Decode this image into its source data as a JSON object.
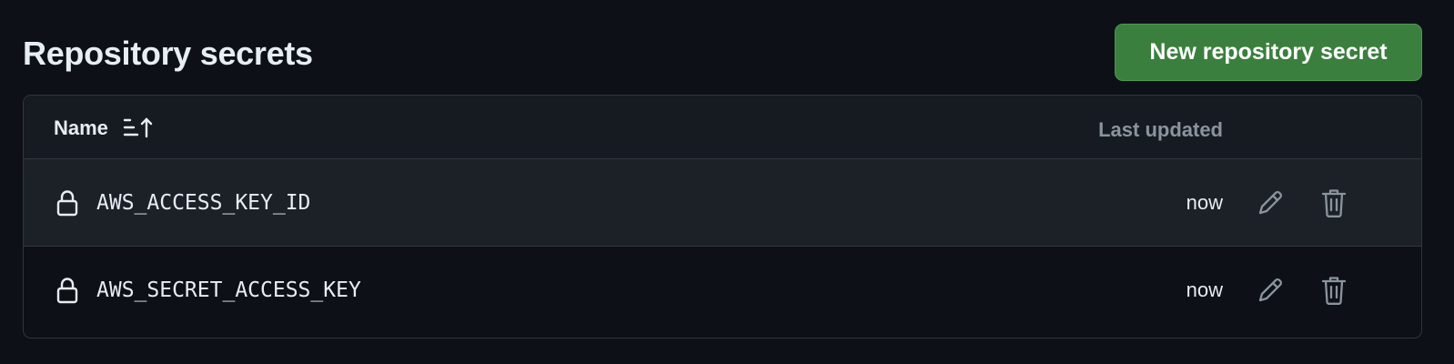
{
  "header": {
    "title": "Repository secrets",
    "new_button_label": "New repository secret"
  },
  "table": {
    "columns": {
      "name": "Name",
      "last_updated": "Last updated"
    },
    "sort_icon": "sort-ascending-icon",
    "rows": [
      {
        "name": "AWS_ACCESS_KEY_ID",
        "updated": "now"
      },
      {
        "name": "AWS_SECRET_ACCESS_KEY",
        "updated": "now"
      }
    ],
    "row_icons": [
      "lock-icon",
      "pencil-icon",
      "trash-icon"
    ]
  },
  "colors": {
    "background": "#0d1117",
    "primary_button": "#3b7f3e",
    "border": "#30363d",
    "muted_text": "#8b949e"
  }
}
